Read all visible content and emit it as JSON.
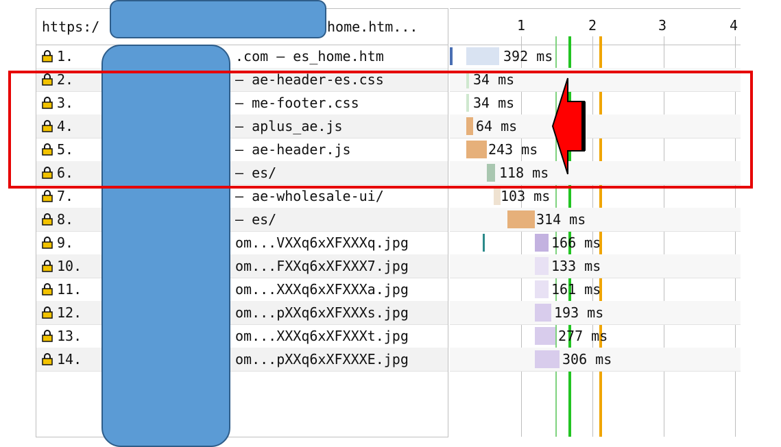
{
  "header": {
    "url_prefix": "https:/",
    "url_suffix": "home.htm..."
  },
  "timeline": {
    "ticks": [
      "1",
      "2",
      "3",
      "4"
    ]
  },
  "rows": [
    {
      "index": "1.",
      "url": ".com – es_home.htm",
      "duration": "392 ms"
    },
    {
      "index": "2.",
      "url": "– ae-header-es.css",
      "duration": "34 ms"
    },
    {
      "index": "3.",
      "url": "– me-footer.css",
      "duration": "34 ms"
    },
    {
      "index": "4.",
      "url": "– aplus_ae.js",
      "duration": "64 ms"
    },
    {
      "index": "5.",
      "url": "– ae-header.js",
      "duration": "243 ms"
    },
    {
      "index": "6.",
      "url": "– es/",
      "duration": "118 ms"
    },
    {
      "index": "7.",
      "url": "– ae-wholesale-ui/",
      "duration": "103 ms"
    },
    {
      "index": "8.",
      "url": "– es/",
      "duration": "314 ms"
    },
    {
      "index": "9.",
      "url": "om...VXXq6xXFXXXq.jpg",
      "duration": "166 ms"
    },
    {
      "index": "10.",
      "url": "om...FXXq6xXFXXX7.jpg",
      "duration": "133 ms"
    },
    {
      "index": "11.",
      "url": "om...XXXq6xXFXXXa.jpg",
      "duration": "161 ms"
    },
    {
      "index": "12.",
      "url": "om...pXXq6xXFXXXs.jpg",
      "duration": "193 ms"
    },
    {
      "index": "13.",
      "url": "om...XXXq6xXFXXXt.jpg",
      "duration": "277 ms"
    },
    {
      "index": "14.",
      "url": "om...pXXq6xXFXXXE.jpg",
      "duration": "306 ms"
    }
  ],
  "colors": {
    "highlight": "#e60000",
    "redaction": "#5b9bd5",
    "dom_content_loaded": "#22c422",
    "load_event": "#f0a500"
  },
  "icons": {
    "row_icon": "lock-icon",
    "callout": "red-arrow-icon"
  }
}
